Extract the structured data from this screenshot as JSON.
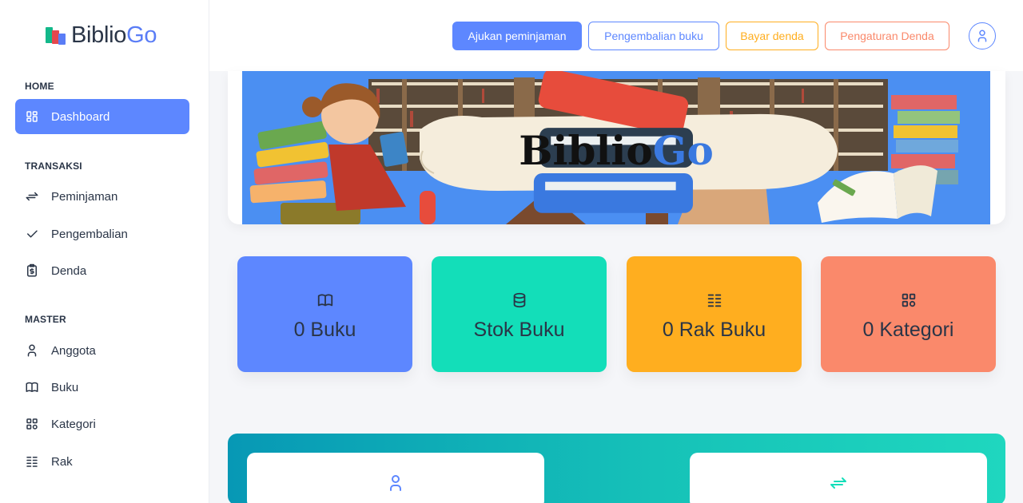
{
  "brand": {
    "part1": "Biblio",
    "part2": "Go"
  },
  "sidebar": {
    "sections": [
      {
        "title": "HOME"
      },
      {
        "title": "TRANSAKSI"
      },
      {
        "title": "MASTER"
      }
    ],
    "items": [
      {
        "label": "Dashboard",
        "icon": "dashboard-icon",
        "active": true
      },
      {
        "label": "Peminjaman",
        "icon": "arrows-exchange-icon"
      },
      {
        "label": "Pengembalian",
        "icon": "check-icon"
      },
      {
        "label": "Denda",
        "icon": "receipt-dollar-icon"
      },
      {
        "label": "Anggota",
        "icon": "user-icon"
      },
      {
        "label": "Buku",
        "icon": "book-icon"
      },
      {
        "label": "Kategori",
        "icon": "category-icon"
      },
      {
        "label": "Rak",
        "icon": "list-details-icon"
      }
    ]
  },
  "header": {
    "buttons": [
      {
        "label": "Ajukan peminjaman",
        "style": "primary"
      },
      {
        "label": "Pengembalian buku",
        "style": "outline-blue"
      },
      {
        "label": "Bayar denda",
        "style": "outline-amber"
      },
      {
        "label": "Pengaturan Denda",
        "style": "outline-red"
      }
    ],
    "profile_icon": "user-icon"
  },
  "banner": {
    "title_part1": "Biblio",
    "title_part2": "Go"
  },
  "stats": [
    {
      "value": "0 Buku",
      "icon": "book-icon",
      "color": "#5d87ff"
    },
    {
      "value": "Stok Buku",
      "icon": "database-icon",
      "color": "#13deb9"
    },
    {
      "value": "0 Rak Buku",
      "icon": "list-details-icon",
      "color": "#ffae1f"
    },
    {
      "value": "0 Kategori",
      "icon": "category-icon",
      "color": "#fa896b"
    }
  ],
  "bottom_cards": [
    {
      "icon": "user-icon",
      "color": "#5d87ff"
    },
    {
      "icon": "arrows-exchange-icon",
      "color": "#13deb9"
    }
  ],
  "colors": {
    "primary": "#5d87ff",
    "success": "#13deb9",
    "warning": "#ffae1f",
    "danger": "#fa896b",
    "text": "#2a3547"
  }
}
